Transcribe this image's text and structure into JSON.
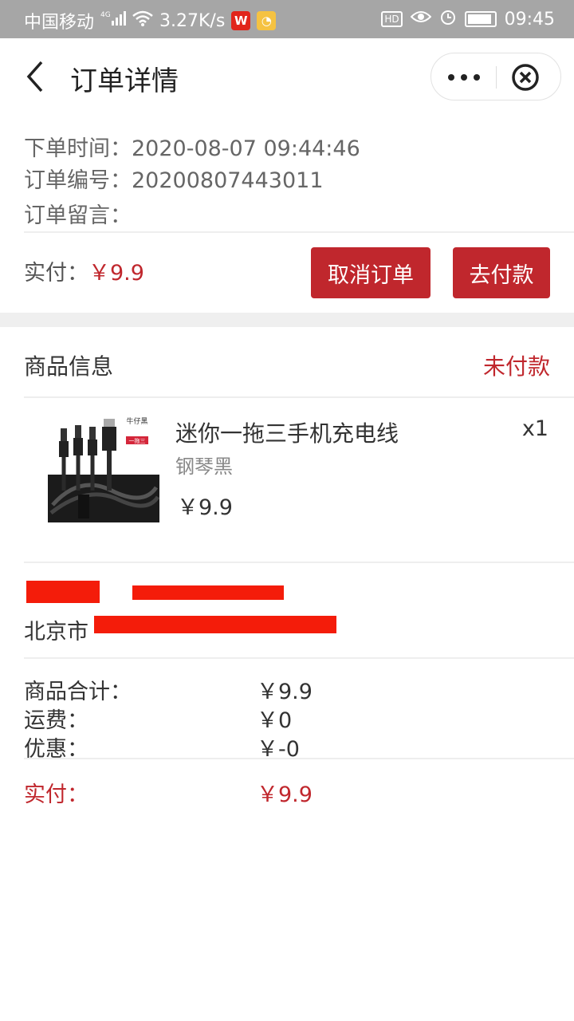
{
  "status_bar": {
    "carrier": "中国移动",
    "net_badge": "4G",
    "speed": "3.27K/s",
    "time": "09:45",
    "hd_badge": "HD",
    "battery_level": 0.9
  },
  "nav": {
    "title": "订单详情"
  },
  "order": {
    "time_label": "下单时间：",
    "time_value": "2020-08-07 09:44:46",
    "number_label": "订单编号：",
    "number_value": "20200807443011",
    "note_label": "订单留言：",
    "paid_label": "实付：",
    "paid_value": "￥9.9",
    "cancel_button": "取消订单",
    "pay_button": "去付款"
  },
  "goods": {
    "section_title": "商品信息",
    "status": "未付款",
    "item": {
      "name": "迷你一拖三手机充电线",
      "spec": "钢琴黑",
      "price": "￥9.9",
      "quantity": "x1",
      "thumb_tag": "牛仔黑",
      "thumb_badge": "一拖三"
    }
  },
  "address": {
    "city_prefix": "北京市"
  },
  "summary": {
    "rows": [
      {
        "label": "商品合计：",
        "value": "￥9.9"
      },
      {
        "label": "运费：",
        "value": "￥0"
      },
      {
        "label": "优惠：",
        "value": "￥-0"
      }
    ],
    "total_label": "实付：",
    "total_value": "￥9.9"
  },
  "colors": {
    "accent": "#c0272d",
    "status_bar": "#a6a6a6",
    "redaction": "#f41c0a"
  }
}
